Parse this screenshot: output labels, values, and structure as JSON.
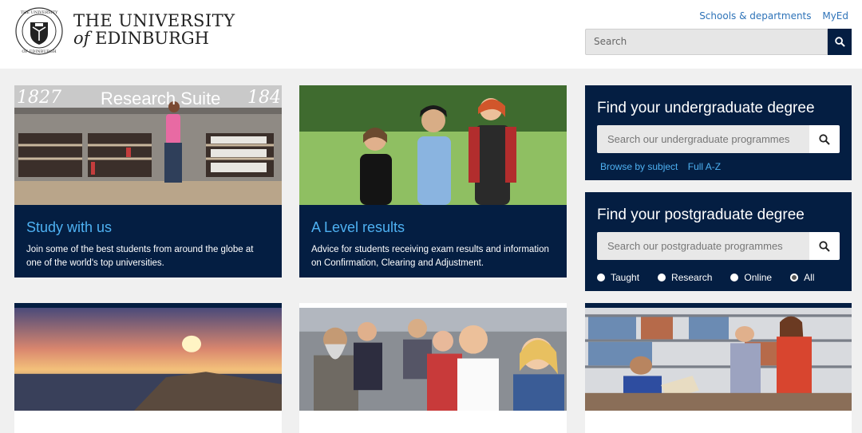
{
  "header": {
    "logo": {
      "line1": "THE UNIVERSITY",
      "line2_of": "of",
      "line2_rest": "EDINBURGH"
    },
    "links": [
      "Schools & departments",
      "MyEd"
    ],
    "search": {
      "placeholder": "Search"
    }
  },
  "cards": [
    {
      "title": "Study with us",
      "desc": "Join some of the best students from around the globe at one of the world's top universities.",
      "image_text": "Research Suite",
      "image_left": "1827",
      "image_right": "184"
    },
    {
      "title": "A Level results",
      "desc": "Advice for students receiving exam results and information on Confirmation, Clearing and Adjustment."
    }
  ],
  "undergrad": {
    "title": "Find your undergraduate degree",
    "placeholder": "Search our undergraduate programmes",
    "links": [
      "Browse by subject",
      "Full A-Z"
    ]
  },
  "postgrad": {
    "title": "Find your postgraduate degree",
    "placeholder": "Search our postgraduate programmes",
    "options": [
      "Taught",
      "Research",
      "Online",
      "All"
    ],
    "selected": "All"
  },
  "colors": {
    "navy": "#041e42",
    "accent": "#4eb1f2",
    "link": "#2e73b8"
  }
}
